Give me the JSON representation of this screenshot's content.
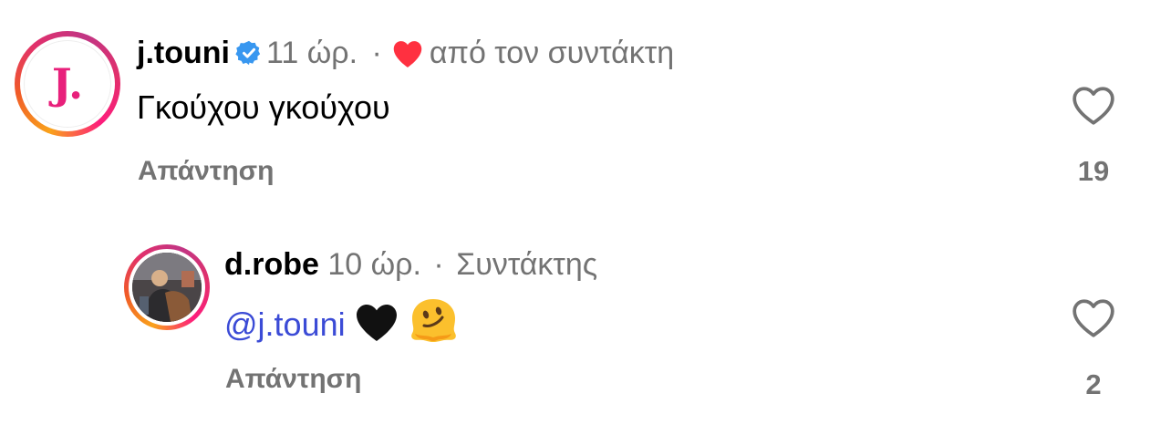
{
  "comments": [
    {
      "username": "j.touni",
      "verified": true,
      "time": "11 ώρ.",
      "separator": "·",
      "liked_by_author": "από τον συντάκτη",
      "avatar_letter": "J.",
      "text": "Γκούχου γκούχου",
      "reply_label": "Απάντηση",
      "like_count": "19"
    },
    {
      "username": "d.robe",
      "time": "10 ώρ.",
      "separator": "·",
      "role": "Συντάκτης",
      "mention": "@j.touni",
      "emojis": [
        "black-heart-icon",
        "melting-face-icon"
      ],
      "reply_label": "Απάντηση",
      "like_count": "2"
    }
  ],
  "colors": {
    "verified_blue": "#3897f0",
    "heart_red": "#ff3040",
    "mention_blue": "#3b4bd6",
    "muted_gray": "#737373"
  }
}
